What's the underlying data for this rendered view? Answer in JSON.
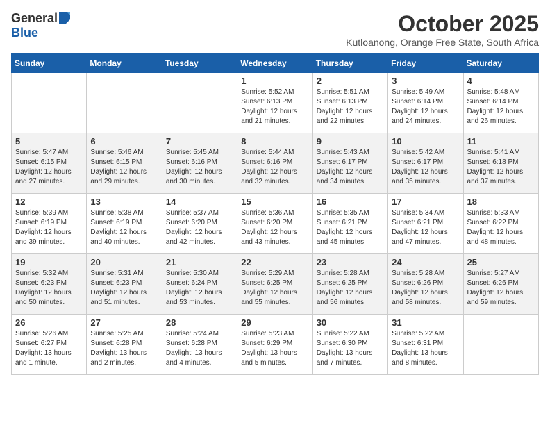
{
  "header": {
    "logo_general": "General",
    "logo_blue": "Blue",
    "month_title": "October 2025",
    "location": "Kutloanong, Orange Free State, South Africa"
  },
  "days_of_week": [
    "Sunday",
    "Monday",
    "Tuesday",
    "Wednesday",
    "Thursday",
    "Friday",
    "Saturday"
  ],
  "weeks": [
    [
      {
        "day": "",
        "sunrise": "",
        "sunset": "",
        "daylight": ""
      },
      {
        "day": "",
        "sunrise": "",
        "sunset": "",
        "daylight": ""
      },
      {
        "day": "",
        "sunrise": "",
        "sunset": "",
        "daylight": ""
      },
      {
        "day": "1",
        "sunrise": "Sunrise: 5:52 AM",
        "sunset": "Sunset: 6:13 PM",
        "daylight": "Daylight: 12 hours and 21 minutes."
      },
      {
        "day": "2",
        "sunrise": "Sunrise: 5:51 AM",
        "sunset": "Sunset: 6:13 PM",
        "daylight": "Daylight: 12 hours and 22 minutes."
      },
      {
        "day": "3",
        "sunrise": "Sunrise: 5:49 AM",
        "sunset": "Sunset: 6:14 PM",
        "daylight": "Daylight: 12 hours and 24 minutes."
      },
      {
        "day": "4",
        "sunrise": "Sunrise: 5:48 AM",
        "sunset": "Sunset: 6:14 PM",
        "daylight": "Daylight: 12 hours and 26 minutes."
      }
    ],
    [
      {
        "day": "5",
        "sunrise": "Sunrise: 5:47 AM",
        "sunset": "Sunset: 6:15 PM",
        "daylight": "Daylight: 12 hours and 27 minutes."
      },
      {
        "day": "6",
        "sunrise": "Sunrise: 5:46 AM",
        "sunset": "Sunset: 6:15 PM",
        "daylight": "Daylight: 12 hours and 29 minutes."
      },
      {
        "day": "7",
        "sunrise": "Sunrise: 5:45 AM",
        "sunset": "Sunset: 6:16 PM",
        "daylight": "Daylight: 12 hours and 30 minutes."
      },
      {
        "day": "8",
        "sunrise": "Sunrise: 5:44 AM",
        "sunset": "Sunset: 6:16 PM",
        "daylight": "Daylight: 12 hours and 32 minutes."
      },
      {
        "day": "9",
        "sunrise": "Sunrise: 5:43 AM",
        "sunset": "Sunset: 6:17 PM",
        "daylight": "Daylight: 12 hours and 34 minutes."
      },
      {
        "day": "10",
        "sunrise": "Sunrise: 5:42 AM",
        "sunset": "Sunset: 6:17 PM",
        "daylight": "Daylight: 12 hours and 35 minutes."
      },
      {
        "day": "11",
        "sunrise": "Sunrise: 5:41 AM",
        "sunset": "Sunset: 6:18 PM",
        "daylight": "Daylight: 12 hours and 37 minutes."
      }
    ],
    [
      {
        "day": "12",
        "sunrise": "Sunrise: 5:39 AM",
        "sunset": "Sunset: 6:19 PM",
        "daylight": "Daylight: 12 hours and 39 minutes."
      },
      {
        "day": "13",
        "sunrise": "Sunrise: 5:38 AM",
        "sunset": "Sunset: 6:19 PM",
        "daylight": "Daylight: 12 hours and 40 minutes."
      },
      {
        "day": "14",
        "sunrise": "Sunrise: 5:37 AM",
        "sunset": "Sunset: 6:20 PM",
        "daylight": "Daylight: 12 hours and 42 minutes."
      },
      {
        "day": "15",
        "sunrise": "Sunrise: 5:36 AM",
        "sunset": "Sunset: 6:20 PM",
        "daylight": "Daylight: 12 hours and 43 minutes."
      },
      {
        "day": "16",
        "sunrise": "Sunrise: 5:35 AM",
        "sunset": "Sunset: 6:21 PM",
        "daylight": "Daylight: 12 hours and 45 minutes."
      },
      {
        "day": "17",
        "sunrise": "Sunrise: 5:34 AM",
        "sunset": "Sunset: 6:21 PM",
        "daylight": "Daylight: 12 hours and 47 minutes."
      },
      {
        "day": "18",
        "sunrise": "Sunrise: 5:33 AM",
        "sunset": "Sunset: 6:22 PM",
        "daylight": "Daylight: 12 hours and 48 minutes."
      }
    ],
    [
      {
        "day": "19",
        "sunrise": "Sunrise: 5:32 AM",
        "sunset": "Sunset: 6:23 PM",
        "daylight": "Daylight: 12 hours and 50 minutes."
      },
      {
        "day": "20",
        "sunrise": "Sunrise: 5:31 AM",
        "sunset": "Sunset: 6:23 PM",
        "daylight": "Daylight: 12 hours and 51 minutes."
      },
      {
        "day": "21",
        "sunrise": "Sunrise: 5:30 AM",
        "sunset": "Sunset: 6:24 PM",
        "daylight": "Daylight: 12 hours and 53 minutes."
      },
      {
        "day": "22",
        "sunrise": "Sunrise: 5:29 AM",
        "sunset": "Sunset: 6:25 PM",
        "daylight": "Daylight: 12 hours and 55 minutes."
      },
      {
        "day": "23",
        "sunrise": "Sunrise: 5:28 AM",
        "sunset": "Sunset: 6:25 PM",
        "daylight": "Daylight: 12 hours and 56 minutes."
      },
      {
        "day": "24",
        "sunrise": "Sunrise: 5:28 AM",
        "sunset": "Sunset: 6:26 PM",
        "daylight": "Daylight: 12 hours and 58 minutes."
      },
      {
        "day": "25",
        "sunrise": "Sunrise: 5:27 AM",
        "sunset": "Sunset: 6:26 PM",
        "daylight": "Daylight: 12 hours and 59 minutes."
      }
    ],
    [
      {
        "day": "26",
        "sunrise": "Sunrise: 5:26 AM",
        "sunset": "Sunset: 6:27 PM",
        "daylight": "Daylight: 13 hours and 1 minute."
      },
      {
        "day": "27",
        "sunrise": "Sunrise: 5:25 AM",
        "sunset": "Sunset: 6:28 PM",
        "daylight": "Daylight: 13 hours and 2 minutes."
      },
      {
        "day": "28",
        "sunrise": "Sunrise: 5:24 AM",
        "sunset": "Sunset: 6:28 PM",
        "daylight": "Daylight: 13 hours and 4 minutes."
      },
      {
        "day": "29",
        "sunrise": "Sunrise: 5:23 AM",
        "sunset": "Sunset: 6:29 PM",
        "daylight": "Daylight: 13 hours and 5 minutes."
      },
      {
        "day": "30",
        "sunrise": "Sunrise: 5:22 AM",
        "sunset": "Sunset: 6:30 PM",
        "daylight": "Daylight: 13 hours and 7 minutes."
      },
      {
        "day": "31",
        "sunrise": "Sunrise: 5:22 AM",
        "sunset": "Sunset: 6:31 PM",
        "daylight": "Daylight: 13 hours and 8 minutes."
      },
      {
        "day": "",
        "sunrise": "",
        "sunset": "",
        "daylight": ""
      }
    ]
  ],
  "row_shading": [
    false,
    true,
    false,
    true,
    false
  ]
}
